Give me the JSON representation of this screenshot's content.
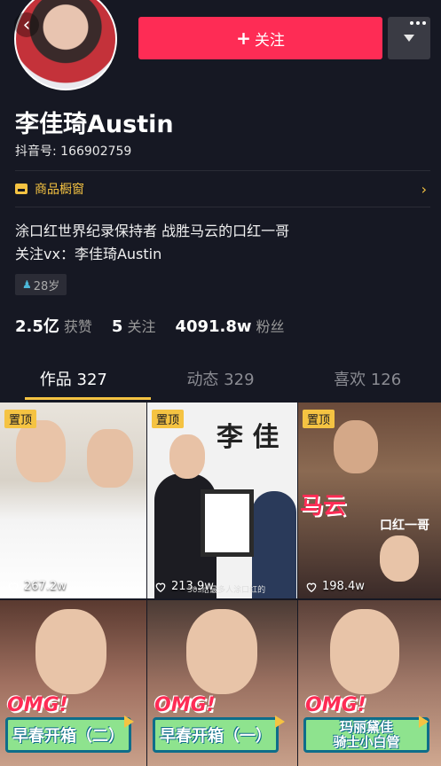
{
  "header": {
    "back_icon": "chevron-left-icon",
    "follow_label": "关注",
    "more_icon": "ellipsis-icon"
  },
  "profile": {
    "name": "李佳琦Austin",
    "douyin_id": "抖音号: 166902759",
    "shop_label": "商品橱窗",
    "bio_line1": "涂口红世界纪录保持者 战胜马云的口红一哥",
    "bio_line2": "关注vx：李佳琦Austin",
    "age_tag": "28岁"
  },
  "stats": {
    "likes_value": "2.5亿",
    "likes_label": "获赞",
    "following_value": "5",
    "following_label": "关注",
    "followers_value": "4091.8w",
    "followers_label": "粉丝"
  },
  "tabs": [
    {
      "label": "作品 327",
      "active": true
    },
    {
      "label": "动态 329",
      "active": false
    },
    {
      "label": "喜欢 126",
      "active": false
    }
  ],
  "videos": [
    {
      "pinned": "置顶",
      "likes": "267.2w"
    },
    {
      "pinned": "置顶",
      "likes": "213.9w",
      "overlay": "李 佳",
      "sub": "30s给最多人涂口红的"
    },
    {
      "pinned": "置顶",
      "likes": "198.4w",
      "overlay": "马云",
      "overlay2": "口红一哥"
    },
    {
      "omg": "OMG!",
      "caption": "早春开箱（二）"
    },
    {
      "omg": "OMG!",
      "caption": "早春开箱（一）"
    },
    {
      "omg": "OMG!",
      "caption_line1": "玛丽黛佳",
      "caption_line2": "骑士小白管"
    }
  ],
  "colors": {
    "background": "#161823",
    "accent": "#fe2c55",
    "gold": "#f5c342"
  }
}
